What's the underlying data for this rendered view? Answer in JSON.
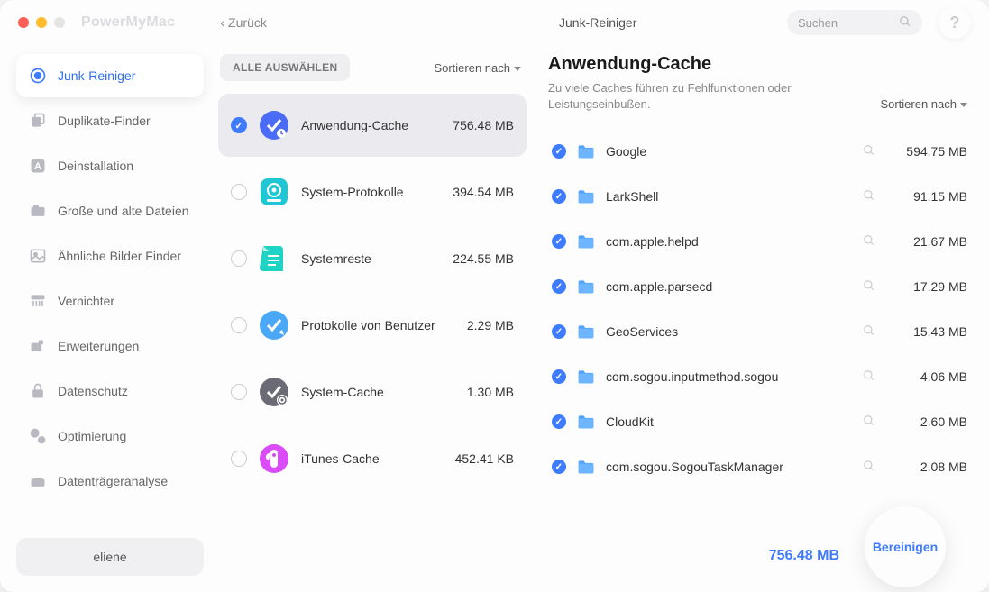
{
  "app_title": "PowerMyMac",
  "back_label": "Zurück",
  "section_title": "Junk-Reiniger",
  "search_placeholder": "Suchen",
  "help_label": "?",
  "sidebar": {
    "items": [
      {
        "label": "Junk-Reiniger",
        "icon": "junk"
      },
      {
        "label": "Duplikate-Finder",
        "icon": "dup"
      },
      {
        "label": "Deinstallation",
        "icon": "uninstall"
      },
      {
        "label": "Große und alte Dateien",
        "icon": "large"
      },
      {
        "label": "Ähnliche Bilder Finder",
        "icon": "similar"
      },
      {
        "label": "Vernichter",
        "icon": "shred"
      },
      {
        "label": "Erweiterungen",
        "icon": "ext"
      },
      {
        "label": "Datenschutz",
        "icon": "privacy"
      },
      {
        "label": "Optimierung",
        "icon": "opt"
      },
      {
        "label": "Datenträgeranalyse",
        "icon": "disk"
      }
    ],
    "user": "eliene"
  },
  "mid": {
    "select_all": "ALLE AUSWÄHLEN",
    "sort_by": "Sortieren nach",
    "categories": [
      {
        "name": "Anwendung-Cache",
        "size": "756.48 MB",
        "selected": true,
        "color": "#4a6cf7"
      },
      {
        "name": "System-Protokolle",
        "size": "394.54 MB",
        "selected": false,
        "color": "#1fc7d4"
      },
      {
        "name": "Systemreste",
        "size": "224.55 MB",
        "selected": false,
        "color": "#1fd4c4"
      },
      {
        "name": "Protokolle von Benutzer",
        "size": "2.29 MB",
        "selected": false,
        "color": "#4aa8f7"
      },
      {
        "name": "System-Cache",
        "size": "1.30 MB",
        "selected": false,
        "color": "#6b6b76"
      },
      {
        "name": "iTunes-Cache",
        "size": "452.41 KB",
        "selected": false,
        "color": "#d94cf7"
      }
    ]
  },
  "right": {
    "title": "Anwendung-Cache",
    "desc": "Zu viele Caches führen zu Fehlfunktionen oder Leistungseinbußen.",
    "sort_by": "Sortieren nach",
    "files": [
      {
        "name": "Google",
        "size": "594.75 MB"
      },
      {
        "name": "LarkShell",
        "size": "91.15 MB"
      },
      {
        "name": "com.apple.helpd",
        "size": "21.67 MB"
      },
      {
        "name": "com.apple.parsecd",
        "size": "17.29 MB"
      },
      {
        "name": "GeoServices",
        "size": "15.43 MB"
      },
      {
        "name": "com.sogou.inputmethod.sogou",
        "size": "4.06 MB"
      },
      {
        "name": "CloudKit",
        "size": "2.60 MB"
      },
      {
        "name": "com.sogou.SogouTaskManager",
        "size": "2.08 MB"
      }
    ]
  },
  "footer": {
    "total": "756.48 MB",
    "clean_label": "Bereinigen"
  }
}
